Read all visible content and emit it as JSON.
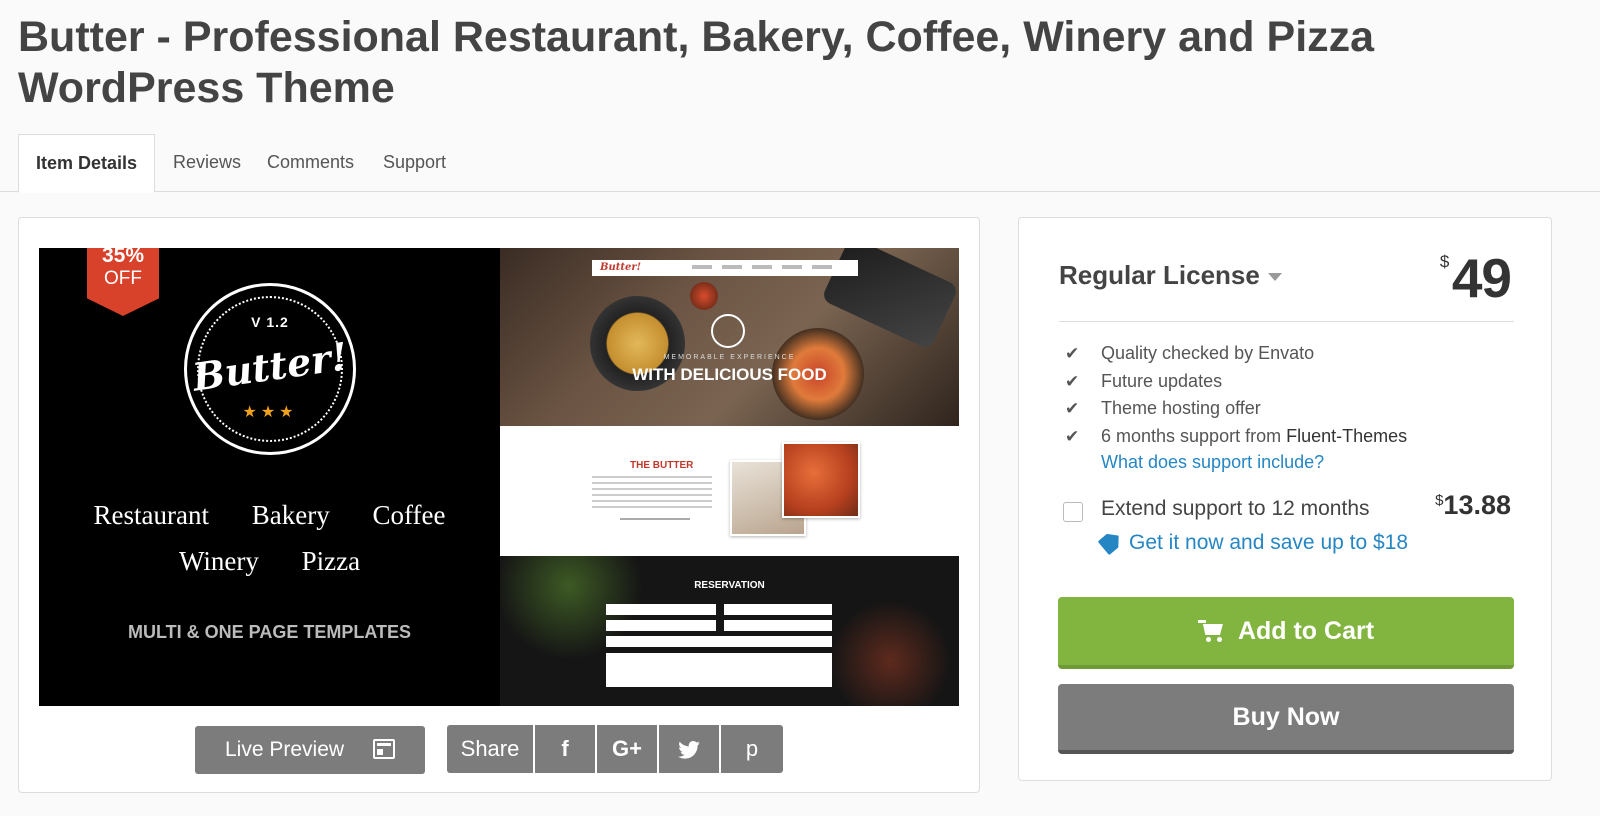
{
  "page": {
    "title": "Butter - Professional Restaurant, Bakery, Coffee, Winery and Pizza WordPress Theme"
  },
  "tabs": [
    {
      "label": "Item Details",
      "active": true
    },
    {
      "label": "Reviews"
    },
    {
      "label": "Comments"
    },
    {
      "label": "Support"
    }
  ],
  "preview": {
    "ribbon_line1": "35%",
    "ribbon_line2": "OFF",
    "seal_version": "V 1.2",
    "seal_brand": "Butter!",
    "seal_stars": "★★★",
    "categories_line1": [
      "Restaurant",
      "Bakery",
      "Coffee"
    ],
    "categories_line2": [
      "Winery",
      "Pizza"
    ],
    "templates_caption": "MULTI & ONE PAGE TEMPLATES",
    "mockup_hero_small": "MEMORABLE EXPERIENCE",
    "mockup_hero_headline": "WITH DELICIOUS FOOD",
    "mockup_about_heading": "THE BUTTER",
    "mockup_reservation_heading": "RESERVATION",
    "mockup_logo": "Butter!"
  },
  "preview_actions": {
    "live_preview_label": "Live Preview",
    "share_label": "Share",
    "social": [
      {
        "icon": "facebook-icon",
        "glyph": "f"
      },
      {
        "icon": "google-plus-icon",
        "glyph": "G+"
      },
      {
        "icon": "twitter-icon",
        "glyph": "🐦"
      },
      {
        "icon": "pinterest-icon",
        "glyph": "p"
      }
    ]
  },
  "purchase": {
    "license_label": "Regular License",
    "price_currency": "$",
    "price_amount": "49",
    "features": [
      {
        "text": "Quality checked by Envato"
      },
      {
        "text": "Future updates"
      },
      {
        "text": "Theme hosting offer"
      },
      {
        "text": "6 months support from ",
        "bold": "Fluent-Themes"
      }
    ],
    "support_link": "What does support include?",
    "extend_label": "Extend support to 12 months",
    "extend_currency": "$",
    "extend_price": "13.88",
    "save_link": "Get it now and save up to $18",
    "add_to_cart_label": "Add to Cart",
    "buy_now_label": "Buy Now"
  },
  "colors": {
    "accent_green": "#82b440",
    "link_blue": "#2686c4",
    "button_gray": "#7c7c7c",
    "ribbon_red": "#d8412a"
  }
}
